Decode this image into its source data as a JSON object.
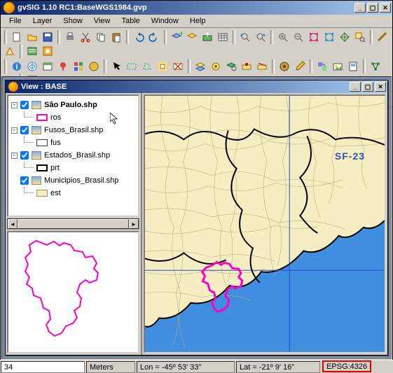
{
  "app": {
    "title": "gvSIG 1.10 RC1:BaseWGS1984.gvp"
  },
  "menu": {
    "file": "File",
    "layer": "Layer",
    "show": "Show",
    "view": "View",
    "table": "Table",
    "window": "Window",
    "help": "Help"
  },
  "locate": {
    "value": "São Paulo.shp"
  },
  "view_window": {
    "title": "View : BASE"
  },
  "toc": {
    "layers": [
      {
        "name": "São Paulo.shp",
        "bold": true,
        "checked": true,
        "expander": "-",
        "legend": {
          "label": "ros",
          "fill": "none",
          "stroke": "#ff00c8",
          "sw": 2
        }
      },
      {
        "name": "Fusos_Brasil.shp",
        "bold": false,
        "checked": true,
        "expander": "-",
        "legend": {
          "label": "fus",
          "fill": "none",
          "stroke": "#2030c0",
          "sw": 1
        }
      },
      {
        "name": "Estados_Brasil.shp",
        "bold": false,
        "checked": true,
        "expander": "-",
        "legend": {
          "label": "prt",
          "fill": "none",
          "stroke": "#000000",
          "sw": 2
        }
      },
      {
        "name": "Municipios_Brasil.shp",
        "bold": false,
        "checked": true,
        "expander": "",
        "legend": {
          "label": "est",
          "fill": "#f5ecc0",
          "stroke": "#a09060",
          "sw": 1
        }
      }
    ]
  },
  "map": {
    "label": "SF-23"
  },
  "status": {
    "scale": "34",
    "units": "Meters",
    "lon": "Lon = -45º 53' 33\"",
    "lat": "Lat = -21º 9' 16\"",
    "epsg": "EPSG:4326"
  },
  "colors": {
    "ocean": "#3f8ee0",
    "land": "#f5eec2",
    "muni": "#b8aa70",
    "state": "#000000",
    "fuso": "#274cc8",
    "sp": "#ff00c8"
  }
}
